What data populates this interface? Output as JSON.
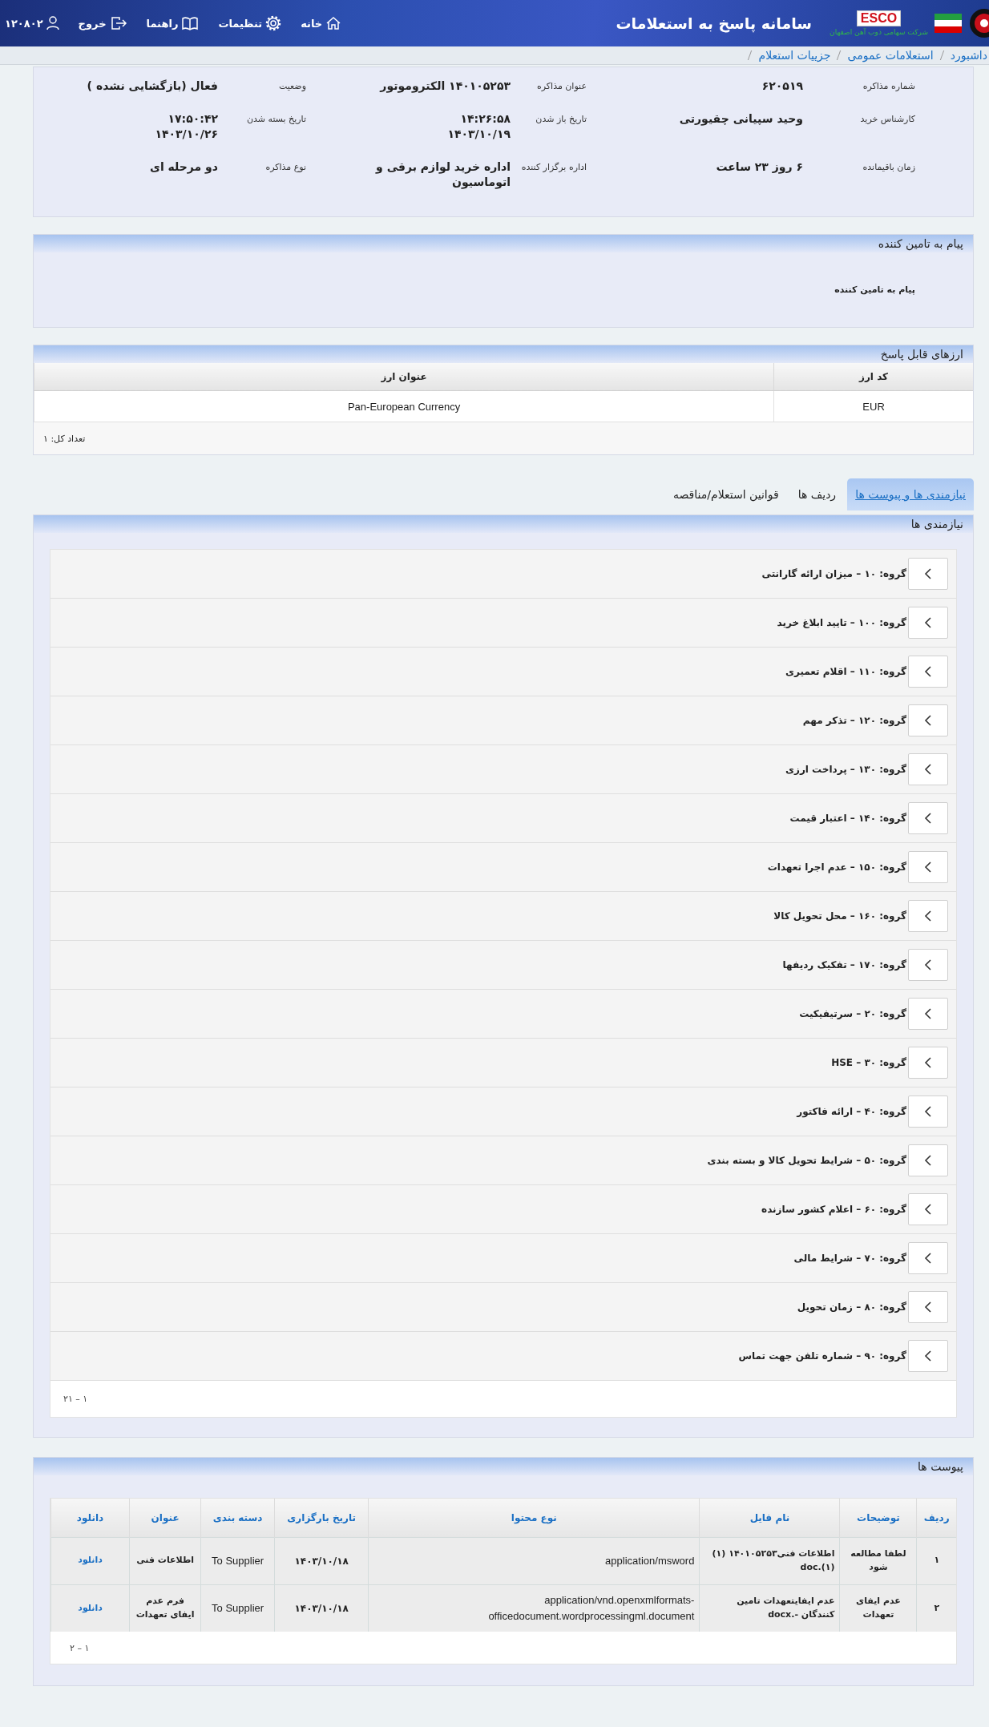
{
  "header": {
    "title": "سامانه پاسخ به استعلامات",
    "logo_text": "ESCO",
    "company": "شرکت سهامی ذوب آهن اصفهان",
    "menu": [
      {
        "label": "خانه",
        "kind": "home"
      },
      {
        "label": "تنظیمات",
        "kind": "settings"
      },
      {
        "label": "راهنما",
        "kind": "help"
      },
      {
        "label": "خروج",
        "kind": "logout"
      }
    ],
    "user": "۱۲۰۸۰۲"
  },
  "breadcrumb": [
    "داشبورد",
    "استعلامات عمومی",
    "جزییات استعلام"
  ],
  "details": [
    {
      "label": "شماره مذاکره",
      "value": "۶۲۰۵۱۹"
    },
    {
      "label": "عنوان مذاکره",
      "value": "۱۴۰۱۰۵۲۵۳ الکتروموتور"
    },
    {
      "label": "وضعیت",
      "value": "فعال (بازگشایی نشده )"
    },
    {
      "label": "کارشناس خرید",
      "value": "وحید سپیانی چقیورتی"
    },
    {
      "label": "تاریخ باز شدن",
      "value": "۱۴:۲۶:۵۸\n۱۴۰۳/۱۰/۱۹"
    },
    {
      "label": "تاریخ بسته شدن",
      "value": "۱۷:۵۰:۴۲\n۱۴۰۳/۱۰/۲۶"
    },
    {
      "label": "زمان باقیمانده",
      "value": "۶ روز ۲۳ ساعت"
    },
    {
      "label": "اداره برگزار کننده",
      "value": "اداره خرید لوازم برقی و\nاتوماسیون"
    },
    {
      "label": "نوع مذاکره",
      "value": "دو مرحله ای"
    }
  ],
  "supplier_message": {
    "title": "پیام به تامین کننده",
    "label": "پیام به تامین کننده"
  },
  "currencies": {
    "title": "ارزهای قابل پاسخ",
    "columns": [
      "کد ارز",
      "عنوان ارز"
    ],
    "rows": [
      [
        "EUR",
        "Pan-European Currency"
      ]
    ],
    "total": "تعداد کل: ۱"
  },
  "tabs": [
    {
      "label": "نیازمندی ها و پیوست ها",
      "selected": true
    },
    {
      "label": "ردیف ها",
      "selected": false
    },
    {
      "label": "قوانین استعلام/مناقصه",
      "selected": false
    }
  ],
  "requirements": {
    "title": "نیازمندی ها",
    "groups": [
      {
        "label": "گروه: ۱۰ – میزان ارائه گارانتی",
        "expanded": false
      },
      {
        "label": "گروه: ۱۰۰ – تایید ابلاغ خرید",
        "expanded": false
      },
      {
        "label": "گروه: ۱۱۰ – اقلام تعمیری",
        "expanded": false
      },
      {
        "label": "گروه: ۱۲۰ – تذکر مهم",
        "expanded": false
      },
      {
        "label": "گروه: ۱۳۰ – پرداخت ارزی",
        "expanded": false
      },
      {
        "label": "گروه: ۱۴۰ – اعتبار قیمت",
        "expanded": false
      },
      {
        "label": "گروه: ۱۵۰ – عدم اجرا تعهدات",
        "expanded": false
      },
      {
        "label": "گروه: ۱۶۰ – محل تحویل کالا",
        "expanded": false
      },
      {
        "label": "گروه: ۱۷۰ – تفکیک ردیفها",
        "expanded": false
      },
      {
        "label": "گروه: ۲۰ – سرتیفیکیت",
        "expanded": false
      },
      {
        "label": "گروه: ۳۰ – HSE",
        "expanded": false
      },
      {
        "label": "گروه: ۴۰ – ارائه فاکتور",
        "expanded": false
      },
      {
        "label": "گروه: ۵۰ – شرایط تحویل کالا و بسته بندی",
        "expanded": false
      },
      {
        "label": "گروه: ۶۰ – اعلام کشور سازنده",
        "expanded": false
      },
      {
        "label": "گروه: ۷۰ – شرایط مالی",
        "expanded": false
      },
      {
        "label": "گروه: ۸۰ – زمان تحویل",
        "expanded": false
      },
      {
        "label": "گروه: ۹۰ – شماره تلفن جهت تماس",
        "expanded": false
      }
    ],
    "range": "۱ – ۲۱"
  },
  "attachments": {
    "title": "پیوست ها",
    "columns": [
      "ردیف",
      "توضیحات",
      "نام فایل",
      "نوع محتوا",
      "تاریخ بارگزاری",
      "دسته بندی",
      "عنوان",
      "دانلود"
    ],
    "rows": [
      {
        "index": "۱",
        "description": "لطفا مطالعه شود",
        "file_name": "اطلاعات فنی۱۴۰۱۰۵۲۵۳ (۱) (۱).doc",
        "content_type": "application/msword",
        "uploaded": "۱۴۰۳/۱۰/۱۸",
        "category": "To Supplier",
        "title": "اطلاعات فنی",
        "download": "دانلود"
      },
      {
        "index": "۲",
        "description": "عدم ایفای تعهدات",
        "file_name": "عدم ایفایتعهدات تامین کنندگان -.docx",
        "content_type": "application/vnd.openxmlformats-officedocument.wordprocessingml.document",
        "uploaded": "۱۴۰۳/۱۰/۱۸",
        "category": "To Supplier",
        "title": "فرم عدم ایفای تعهدات",
        "download": "دانلود"
      }
    ],
    "range": "۱ – ۲"
  }
}
